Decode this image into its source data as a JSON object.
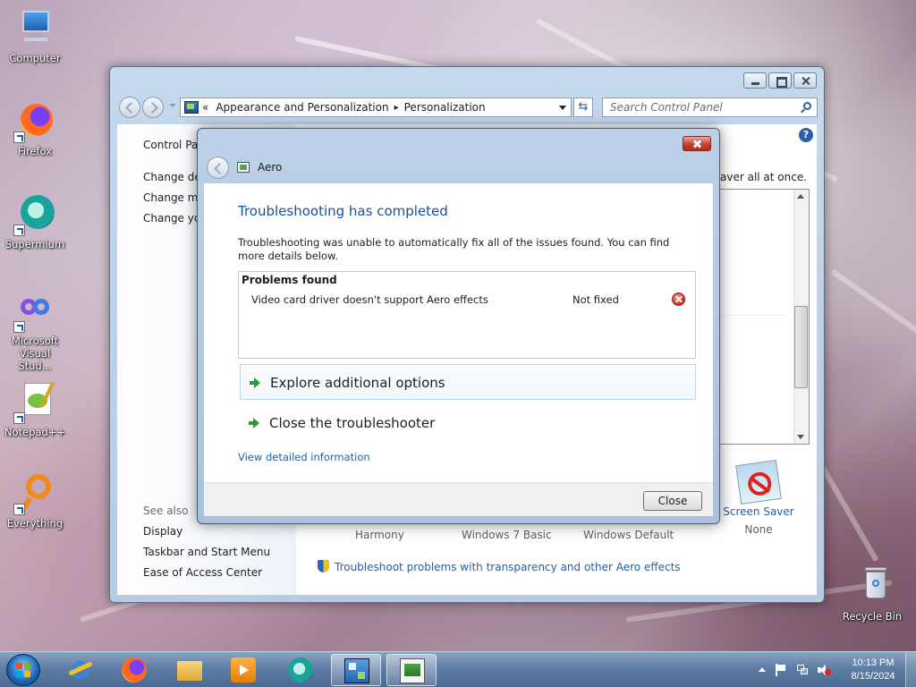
{
  "desktop": {
    "icons": [
      {
        "label": "Computer",
        "icon": "computer-icon"
      },
      {
        "label": "Firefox",
        "icon": "firefox-icon"
      },
      {
        "label": "Supermium",
        "icon": "supermium-icon"
      },
      {
        "label": "Microsoft Visual Stud...",
        "icon": "visual-studio-icon"
      },
      {
        "label": "Notepad++",
        "icon": "notepadpp-icon"
      },
      {
        "label": "Everything",
        "icon": "everything-icon"
      },
      {
        "label": "Recycle Bin",
        "icon": "recycle-bin-icon"
      }
    ]
  },
  "control_panel": {
    "breadcrumb": {
      "overflow": "«",
      "items": [
        "Appearance and Personalization",
        "Personalization"
      ]
    },
    "search_placeholder": "Search Control Panel",
    "left": {
      "home": "Control Pan",
      "links": [
        "Change des",
        "Change mo",
        "Change you"
      ],
      "see_also_heading": "See also",
      "see_also": [
        "Display",
        "Taskbar and Start Menu",
        "Ease of Access Center"
      ]
    },
    "intro_text": "aver all at once.",
    "screen_saver": {
      "label": "Screen Saver",
      "value": "None"
    },
    "themes_bottom": [
      "Harmony",
      "Windows 7 Basic",
      "Windows Default"
    ],
    "troubleshoot_link": "Troubleshoot problems with transparency and other Aero effects"
  },
  "dialog": {
    "title": "Aero",
    "heading": "Troubleshooting has completed",
    "description": "Troubleshooting was unable to automatically fix all of the issues found. You can find more details below.",
    "problems_heading": "Problems found",
    "problems": [
      {
        "name": "Video card driver doesn't support Aero effects",
        "status": "Not fixed",
        "icon": "error-icon"
      }
    ],
    "options": [
      "Explore additional options",
      "Close the troubleshooter"
    ],
    "details_link": "View detailed information",
    "close_button": "Close"
  },
  "taskbar": {
    "pinned": [
      "internet-explorer-icon",
      "firefox-icon",
      "file-explorer-icon",
      "media-player-icon",
      "supermium-icon",
      "control-panel-icon",
      "troubleshooter-icon"
    ],
    "clock_time": "10:13 PM",
    "clock_date": "8/15/2024"
  },
  "colors": {
    "link": "#1f5fb3",
    "heading": "#1a4f9c",
    "success_arrow": "#2e9a35",
    "error": "#c62a22"
  }
}
